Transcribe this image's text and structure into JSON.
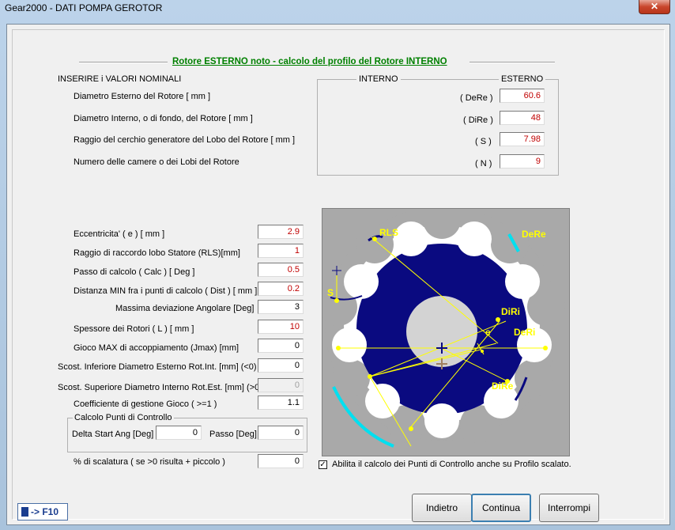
{
  "window": {
    "title": "Gear2000 - DATI POMPA GEROTOR",
    "close_glyph": "✕"
  },
  "heading": "Rotore ESTERNO noto - calcolo del profilo del Rotore INTERNO",
  "nominal": {
    "section_label": "INSERIRE i VALORI NOMINALI",
    "col_interno": "INTERNO",
    "col_esterno": "ESTERNO",
    "rows": [
      {
        "label": "Diametro Esterno del Rotore [ mm ]",
        "symbol": "( DeRe )",
        "value": "60.6"
      },
      {
        "label": "Diametro Interno, o di fondo, del Rotore [ mm ]",
        "symbol": "( DiRe )",
        "value": "48"
      },
      {
        "label": "Raggio del cerchio generatore del Lobo del Rotore [ mm ]",
        "symbol": "( S )",
        "value": "7.98"
      },
      {
        "label": "Numero delle camere o dei Lobi del Rotore",
        "symbol": "( N )",
        "value": "9"
      }
    ]
  },
  "params": [
    {
      "label": "Eccentricita'  ( e ) [ mm ]",
      "value": "2.9",
      "red": true,
      "disabled": false
    },
    {
      "label": "Raggio di raccordo lobo Statore (RLS)[mm]",
      "value": "1",
      "red": true,
      "disabled": false
    },
    {
      "label": "Passo di calcolo ( Calc ) [ Deg ]",
      "value": "0.5",
      "red": true,
      "disabled": false
    },
    {
      "label": "Distanza MIN fra i punti di calcolo ( Dist ) [ mm ]",
      "value": "0.2",
      "red": true,
      "disabled": false
    },
    {
      "label": "Massima deviazione Angolare [Deg]",
      "value": "3",
      "red": false,
      "disabled": false
    },
    {
      "label": "Spessore dei Rotori ( L ) [ mm ]",
      "value": "10",
      "red": true,
      "disabled": false
    },
    {
      "label": "Gioco MAX di accoppiamento (Jmax) [mm]",
      "value": "0",
      "red": false,
      "disabled": false
    },
    {
      "label": "Scost. Inferiore Diametro Esterno Rot.Int. [mm] (<0)",
      "value": "0",
      "red": false,
      "disabled": false
    },
    {
      "label": "Scost. Superiore Diametro Interno Rot.Est. [mm] (>0)",
      "value": "0",
      "red": false,
      "disabled": true
    },
    {
      "label": "Coefficiente di gestione Gioco ( >=1 )",
      "value": "1.1",
      "red": false,
      "disabled": false
    }
  ],
  "control_points": {
    "group_label": "Calcolo Punti di Controllo",
    "delta_label": "Delta Start Ang [Deg]",
    "delta_value": "0",
    "passo_label": "Passo [Deg]",
    "passo_value": "0"
  },
  "scaling": {
    "label": "% di scalatura ( se >0 risulta + piccolo )",
    "value": "0"
  },
  "checkbox": {
    "label": "Abilita il calcolo dei Punti di Controllo anche su Profilo scalato.",
    "checked": true,
    "mark": "✓"
  },
  "diagram": {
    "labels": {
      "rls": "RLS",
      "dere": "DeRe",
      "diri": "DiRi",
      "deri": "DeRi",
      "e": "e",
      "dire": "DiRe",
      "s": "S"
    },
    "colors": {
      "background": "#a9a9a9",
      "rotor": "#0a0a80",
      "hub": "#d3d3d3",
      "highlight": "#00e0f0",
      "labels": "#ffff00"
    }
  },
  "buttons": {
    "back": "Indietro",
    "continue": "Continua",
    "stop": "Interrompi"
  },
  "calculator": {
    "label": "-> F10"
  }
}
